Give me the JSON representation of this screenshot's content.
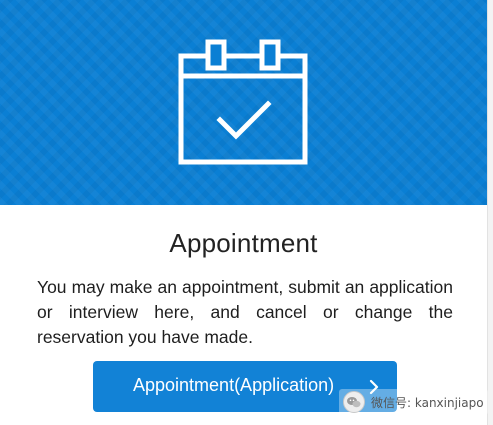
{
  "hero": {
    "icon": "calendar-check-icon",
    "background_color": "#0a7fd4"
  },
  "title": "Appointment",
  "description": "You may make an appointment, submit an application or interview here, and cancel or change the reservation you have made.",
  "button": {
    "label": "Appointment(Application)",
    "icon": "chevron-right-icon",
    "color": "#1282d6"
  },
  "watermark": {
    "icon": "wechat-logo-icon",
    "text": "微信号: kanxinjiapo"
  }
}
